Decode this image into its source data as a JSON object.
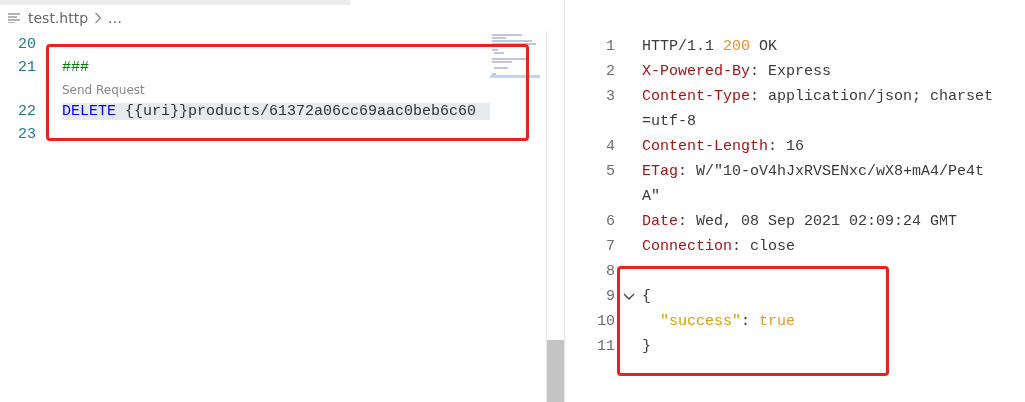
{
  "editor": {
    "breadcrumb": {
      "file": "test.http",
      "ellipsis": "…"
    },
    "lines": [
      {
        "number": "20"
      },
      {
        "number": "21",
        "tokens": [
          {
            "kind": "comment",
            "text": "###"
          }
        ],
        "codelens": "Send Request"
      },
      {
        "number": "22",
        "current": true,
        "tokens": [
          {
            "kind": "method",
            "text": "DELETE"
          },
          {
            "kind": "text",
            "text": " {{uri}}products/61372a06cc69aac0beb6c60"
          }
        ]
      },
      {
        "number": "23"
      }
    ],
    "highlight": {
      "color": "#e8231f"
    }
  },
  "response": {
    "lines": [
      {
        "number": "1",
        "rows": [
          [
            {
              "kind": "plain",
              "text": "HTTP/1.1 "
            },
            {
              "kind": "status",
              "text": "200"
            },
            {
              "kind": "plain",
              "text": " OK"
            }
          ]
        ]
      },
      {
        "number": "2",
        "rows": [
          [
            {
              "kind": "header",
              "text": "X-Powered-By"
            },
            {
              "kind": "plain",
              "text": ": Express"
            }
          ]
        ]
      },
      {
        "number": "3",
        "rows": [
          [
            {
              "kind": "header",
              "text": "Content-Type"
            },
            {
              "kind": "plain",
              "text": ": application/json; charset"
            }
          ],
          [
            {
              "kind": "plain",
              "text": "=utf-8"
            }
          ]
        ]
      },
      {
        "number": "4",
        "rows": [
          [
            {
              "kind": "header",
              "text": "Content-Length"
            },
            {
              "kind": "plain",
              "text": ": 16"
            }
          ]
        ]
      },
      {
        "number": "5",
        "rows": [
          [
            {
              "kind": "header",
              "text": "ETag"
            },
            {
              "kind": "plain",
              "text": ": W/\"10-oV4hJxRVSENxc/wX8+mA4/Pe4t"
            }
          ],
          [
            {
              "kind": "plain",
              "text": "A\""
            }
          ]
        ]
      },
      {
        "number": "6",
        "rows": [
          [
            {
              "kind": "header",
              "text": "Date"
            },
            {
              "kind": "plain",
              "text": ": Wed, 08 Sep 2021 02:09:24 GMT"
            }
          ]
        ]
      },
      {
        "number": "7",
        "rows": [
          [
            {
              "kind": "header",
              "text": "Connection"
            },
            {
              "kind": "plain",
              "text": ": close"
            }
          ]
        ]
      },
      {
        "number": "8",
        "rows": [
          []
        ]
      },
      {
        "number": "9",
        "expanded": true,
        "rows": [
          [
            {
              "kind": "plain",
              "text": "{"
            }
          ]
        ]
      },
      {
        "number": "10",
        "rows": [
          [
            {
              "kind": "plain",
              "text": "  "
            },
            {
              "kind": "key",
              "text": "\"success\""
            },
            {
              "kind": "plain",
              "text": ": "
            },
            {
              "kind": "bool",
              "text": "true"
            }
          ]
        ]
      },
      {
        "number": "11",
        "rows": [
          [
            {
              "kind": "plain",
              "text": "}"
            }
          ]
        ]
      }
    ],
    "highlight": {
      "color": "#e8231f"
    }
  }
}
